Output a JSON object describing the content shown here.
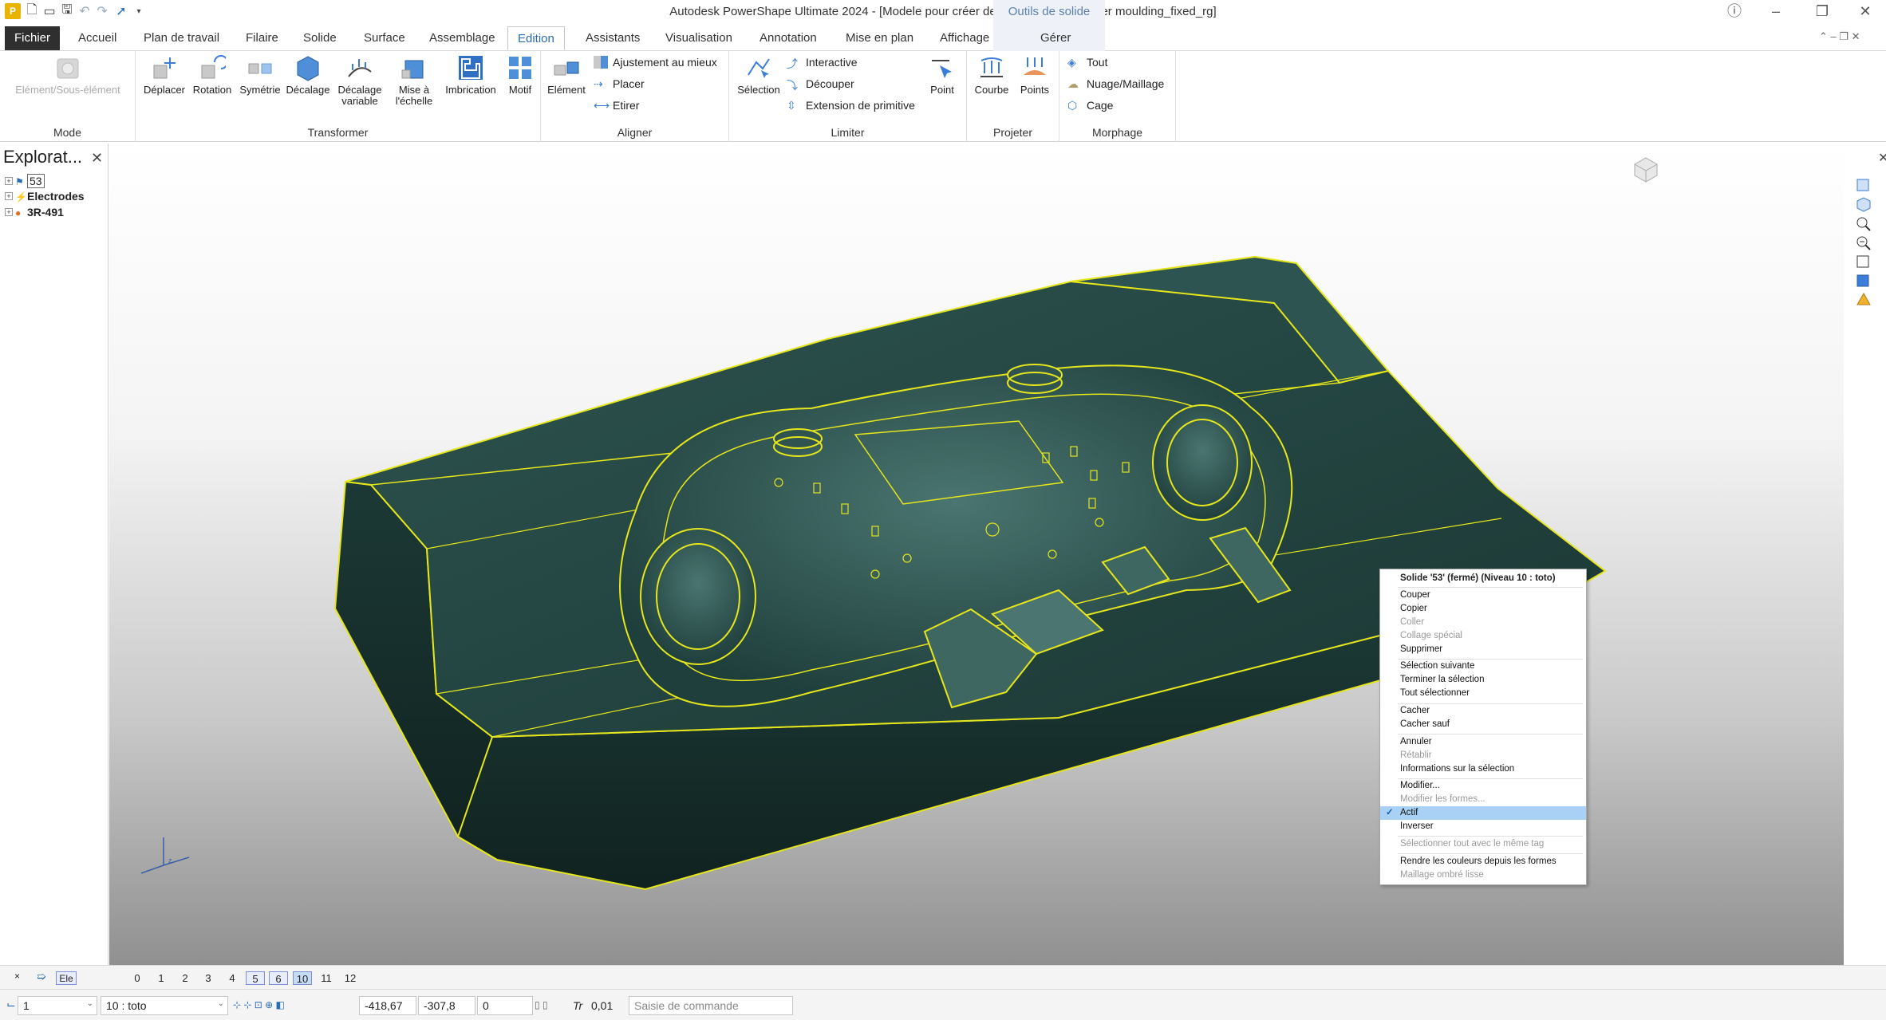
{
  "app": {
    "window_title": "Autodesk PowerShape Ultimate 2024 - [Modele pour créer des électrodes_Speaker moulding_fixed_rg]",
    "context_group": "Outils de solide"
  },
  "tabs": [
    "Fichier",
    "Accueil",
    "Plan de travail",
    "Filaire",
    "Solide",
    "Surface",
    "Assemblage",
    "Edition",
    "Assistants",
    "Visualisation",
    "Annotation",
    "Mise en plan",
    "Affichage",
    "Gérer"
  ],
  "ribbon": {
    "mode": {
      "label": "Mode",
      "element_sub": "Elément/Sous-élément"
    },
    "transformer": {
      "label": "Transformer",
      "buttons": [
        "Déplacer",
        "Rotation",
        "Symétrie",
        "Décalage",
        "Décalage variable",
        "Mise à l'échelle",
        "Imbrication",
        "Motif"
      ]
    },
    "aligner": {
      "label": "Aligner",
      "element": "Elément",
      "items": [
        "Ajustement au mieux",
        "Placer",
        "Etirer"
      ]
    },
    "limiter": {
      "label": "Limiter",
      "selection": "Sélection",
      "items": [
        "Interactive",
        "Découper",
        "Extension de primitive"
      ],
      "point": "Point"
    },
    "projeter": {
      "label": "Projeter",
      "items": [
        "Courbe",
        "Points"
      ]
    },
    "morphage": {
      "label": "Morphage",
      "items": [
        "Tout",
        "Nuage/Maillage",
        "Cage"
      ]
    }
  },
  "explorer": {
    "title": "Explorat...",
    "items": [
      "53",
      "Electrodes",
      "3R-491"
    ]
  },
  "context_menu": {
    "title": "Solide '53' (fermé)  (Niveau 10 : toto)",
    "items": [
      {
        "label": "Couper",
        "state": "enabled"
      },
      {
        "label": "Copier",
        "state": "enabled"
      },
      {
        "label": "Coller",
        "state": "disabled"
      },
      {
        "label": "Collage spécial",
        "state": "disabled"
      },
      {
        "label": "Supprimer",
        "state": "enabled"
      },
      {
        "label": "Sélection suivante",
        "state": "enabled"
      },
      {
        "label": "Terminer la sélection",
        "state": "enabled"
      },
      {
        "label": "Tout sélectionner",
        "state": "enabled"
      },
      {
        "label": "Cacher",
        "state": "enabled"
      },
      {
        "label": "Cacher sauf",
        "state": "enabled"
      },
      {
        "label": "Annuler",
        "state": "enabled"
      },
      {
        "label": "Rétablir",
        "state": "disabled"
      },
      {
        "label": "Informations sur la sélection",
        "state": "enabled"
      },
      {
        "label": "Modifier...",
        "state": "enabled"
      },
      {
        "label": "Modifier les formes...",
        "state": "disabled"
      },
      {
        "label": "Actif",
        "state": "checked"
      },
      {
        "label": "Inverser",
        "state": "enabled"
      },
      {
        "label": "Sélectionner tout avec le même tag",
        "state": "disabled"
      },
      {
        "label": "Rendre les couleurs depuis les formes",
        "state": "enabled"
      },
      {
        "label": "Maillage ombré lisse",
        "state": "disabled"
      }
    ]
  },
  "levels": {
    "button": "Ele",
    "numbers": [
      "0",
      "1",
      "2",
      "3",
      "4",
      "5",
      "6",
      "10",
      "11",
      "12"
    ],
    "on": [
      "5",
      "6",
      "10"
    ],
    "current": "10"
  },
  "status": {
    "workplane": "1",
    "level": "10 : toto",
    "x": "-418,67",
    "y": "-307,8",
    "z": "0",
    "tolerance_label": "Tr",
    "tolerance": "0,01",
    "command_placeholder": "Saisie de commande"
  },
  "colors": {
    "model_fill": "#1f3f3c",
    "edge_highlight": "#e6e61c",
    "selection_blue": "#a8d1f5",
    "accent": "#2b6cb0"
  }
}
